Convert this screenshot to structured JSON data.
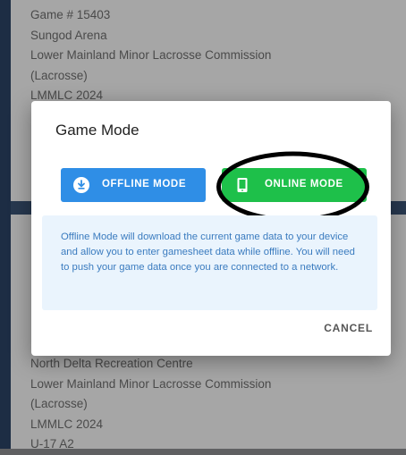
{
  "background": {
    "top_card_lines": [
      "Game # 15403",
      "Sungod Arena",
      "Lower Mainland Minor Lacrosse Commission",
      "(Lacrosse)",
      "LMMLC 2024"
    ],
    "bottom_card_lines": [
      "North Delta Recreation Centre",
      "Lower Mainland Minor Lacrosse Commission",
      "(Lacrosse)",
      "LMMLC 2024",
      "U-17 A2"
    ]
  },
  "dialog": {
    "title": "Game Mode",
    "offline_button": {
      "label": "OFFLINE MODE",
      "icon": "download-circle-icon",
      "color": "#2f8ee6"
    },
    "online_button": {
      "label": "ONLINE MODE",
      "icon": "tablet-icon",
      "color": "#1ec04a"
    },
    "info_text": "Offline Mode will download the current game data to your device and allow you to enter gamesheet data while offline. You will need to push your game data once you are connected to a network.",
    "cancel_label": "CANCEL"
  }
}
